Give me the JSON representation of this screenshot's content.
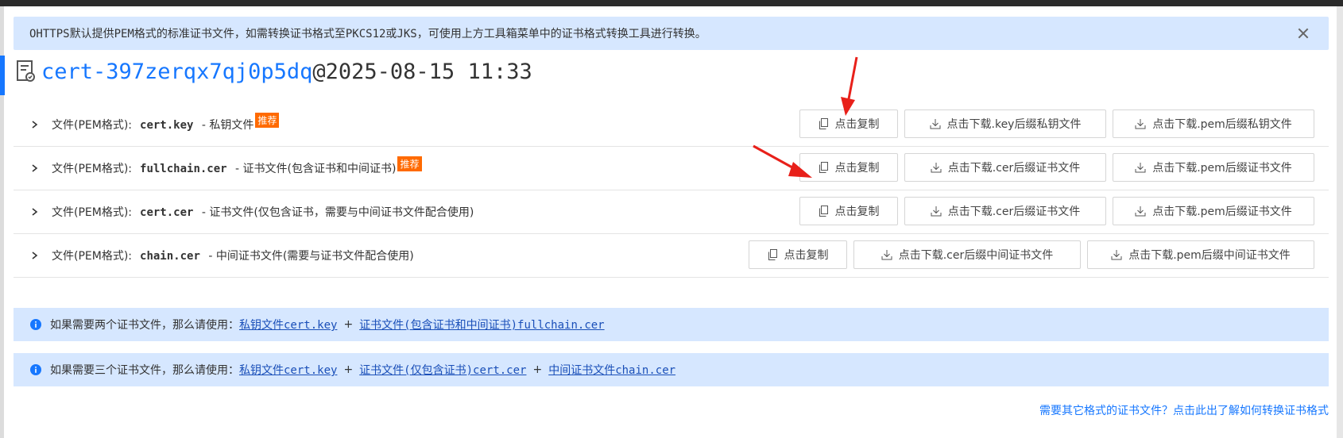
{
  "notice": {
    "text": "OHTTPS默认提供PEM格式的标准证书文件，如需转换证书格式至PKCS12或JKS，可使用上方工具箱菜单中的证书格式转换工具进行转换。"
  },
  "title": {
    "name": "cert-397zerqx7qj0p5dq",
    "date": "@2025-08-15 11:33"
  },
  "rows": [
    {
      "format": "文件(PEM格式):",
      "filename": "cert.key",
      "desc": "- 私钥文件",
      "badge": "推荐",
      "copy": "点击复制",
      "dl1": "点击下载.key后缀私钥文件",
      "dl2": "点击下载.pem后缀私钥文件"
    },
    {
      "format": "文件(PEM格式):",
      "filename": "fullchain.cer",
      "desc": "- 证书文件(包含证书和中间证书)",
      "badge": "推荐",
      "copy": "点击复制",
      "dl1": "点击下载.cer后缀证书文件",
      "dl2": "点击下载.pem后缀证书文件"
    },
    {
      "format": "文件(PEM格式):",
      "filename": "cert.cer",
      "desc": "- 证书文件(仅包含证书，需要与中间证书文件配合使用)",
      "badge": "",
      "copy": "点击复制",
      "dl1": "点击下载.cer后缀证书文件",
      "dl2": "点击下载.pem后缀证书文件"
    },
    {
      "format": "文件(PEM格式):",
      "filename": "chain.cer",
      "desc": "- 中间证书文件(需要与证书文件配合使用)",
      "badge": "",
      "copy": "点击复制",
      "dl1": "点击下载.cer后缀中间证书文件",
      "dl2": "点击下载.pem后缀中间证书文件"
    }
  ],
  "info1": {
    "prefix": "如果需要两个证书文件，那么请使用：",
    "link1": "私钥文件cert.key",
    "plus": "+",
    "link2": "证书文件(包含证书和中间证书)fullchain.cer"
  },
  "info2": {
    "prefix": "如果需要三个证书文件，那么请使用：",
    "link1": "私钥文件cert.key",
    "plus1": "+",
    "link2": "证书文件(仅包含证书)cert.cer",
    "plus2": "+",
    "link3": "中间证书文件chain.cer"
  },
  "footer": {
    "link": "需要其它格式的证书文件？点击此出了解如何转换证书格式"
  },
  "colors": {
    "accent": "#1677ff",
    "notice_bg": "#d6e7ff",
    "badge": "#ff6a00",
    "annotation_arrow": "#e8201a"
  }
}
